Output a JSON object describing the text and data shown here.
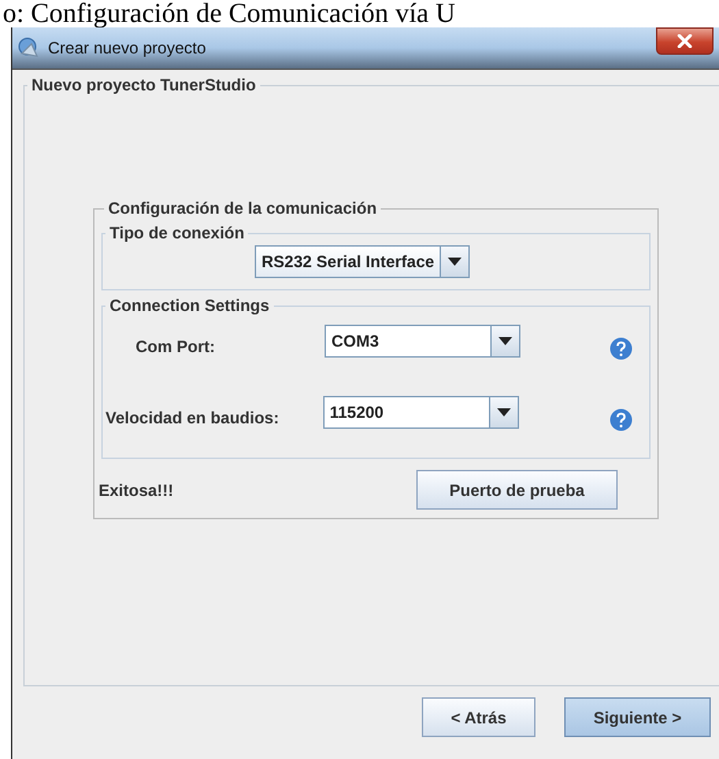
{
  "caption": "o: Configuración de Comunicación vía U",
  "window": {
    "title": "Crear nuevo proyecto"
  },
  "project_panel": {
    "title": "Nuevo proyecto TunerStudio"
  },
  "communication": {
    "title": "Configuración de la comunicación",
    "connection_type": {
      "title": "Tipo de conexión",
      "value": "RS232 Serial Interface"
    },
    "connection_settings": {
      "title": "Connection Settings",
      "fields": [
        {
          "label": "Com Port:",
          "value": "COM3",
          "help": true
        },
        {
          "label": "Velocidad en baudios:",
          "value": "115200",
          "help": true
        }
      ]
    },
    "status": "Exitosa!!!",
    "test_button": "Puerto de prueba"
  },
  "buttons": [
    {
      "label": "< Atrás",
      "default": false
    },
    {
      "label": "Siguiente >",
      "default": true
    }
  ]
}
